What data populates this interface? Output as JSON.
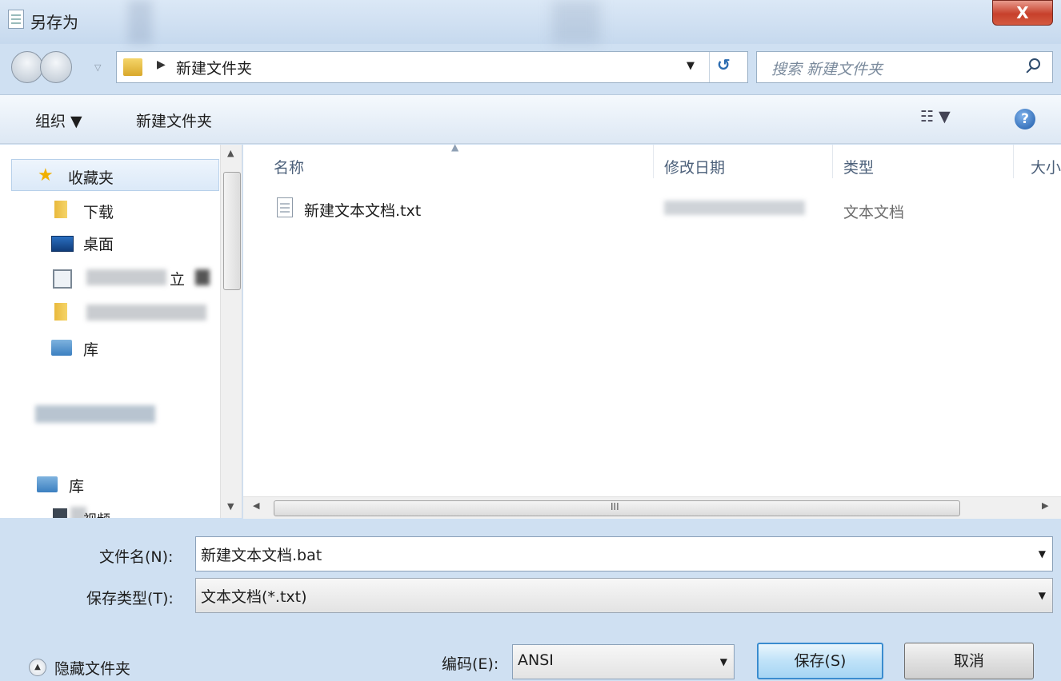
{
  "window": {
    "title": "另存为",
    "close_label": "X"
  },
  "address": {
    "path": "新建文件夹",
    "search_placeholder": "搜索 新建文件夹"
  },
  "toolbar": {
    "organize": "组织 ▼",
    "new_folder": "新建文件夹",
    "view": "☷ ▼",
    "help": "?"
  },
  "sidebar": {
    "favorites": "收藏夹",
    "downloads": "下载",
    "desktop": "桌面",
    "recent_partial": "立",
    "libraries": "库",
    "libraries_2": "库",
    "videos_partial": "视频"
  },
  "columns": {
    "name": "名称",
    "modified": "修改日期",
    "type": "类型",
    "size": "大小"
  },
  "files": [
    {
      "name": "新建文本文档.txt",
      "type": "文本文档"
    }
  ],
  "form": {
    "filename_label": "文件名(N):",
    "filename_value": "新建文本文档.bat",
    "filetype_label": "保存类型(T):",
    "filetype_value": "文本文档(*.txt)",
    "encoding_label": "编码(E):",
    "encoding_value": "ANSI",
    "save": "保存(S)",
    "cancel": "取消",
    "hide_folders": "隐藏文件夹"
  }
}
